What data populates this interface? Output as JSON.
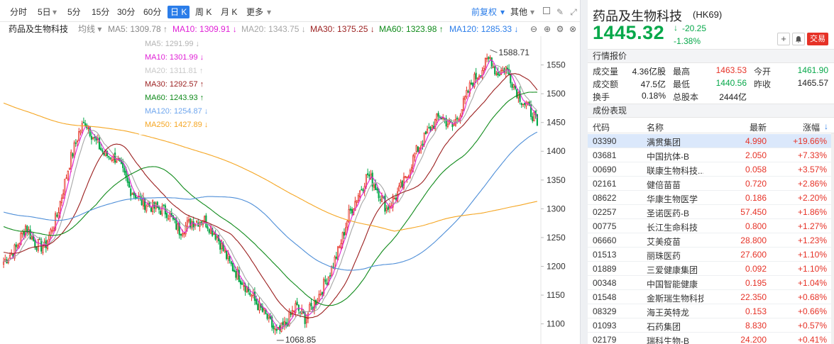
{
  "toolbar": {
    "periods": [
      "分时",
      "5日",
      "5分",
      "15分",
      "30分",
      "60分",
      "日 K",
      "周 K",
      "月 K",
      "更多"
    ],
    "active_index": 6,
    "fuquan": "前复权",
    "other": "其他"
  },
  "ma_bar": {
    "title": "药品及生物科技",
    "type_label": "均线",
    "items": [
      {
        "text": "MA5: 1309.78 ↑",
        "color": "#888888"
      },
      {
        "text": "MA10: 1309.91 ↓",
        "color": "#e021d6"
      },
      {
        "text": "MA20: 1343.75 ↓",
        "color": "#a6a6a6"
      },
      {
        "text": "MA30: 1375.25 ↓",
        "color": "#9b1f1f"
      },
      {
        "text": "MA60: 1323.98 ↑",
        "color": "#0f8a1a"
      },
      {
        "text": "MA120: 1285.33 ↓",
        "color": "#2b7de9"
      }
    ]
  },
  "chart_data": {
    "type": "candlestick",
    "y_ticks": [
      1100,
      1150,
      1200,
      1250,
      1300,
      1350,
      1400,
      1450,
      1500,
      1550
    ],
    "ylim": [
      1065,
      1600
    ],
    "high_label": "1588.71",
    "low_label": "1068.85",
    "last_close": 1445.32,
    "legend": [
      {
        "text": "MA5: 1291.99 ↓",
        "color": "#b3b3b3"
      },
      {
        "text": "MA10: 1301.99 ↓",
        "color": "#e021d6"
      },
      {
        "text": "MA20: 1311.81 ↑",
        "color": "#c9c9c9"
      },
      {
        "text": "MA30: 1292.57 ↑",
        "color": "#9b1f1f"
      },
      {
        "text": "MA60: 1243.93 ↑",
        "color": "#0f8a1a"
      },
      {
        "text": "MA120: 1254.87 ↓",
        "color": "#6fa6ee"
      },
      {
        "text": "MA250: 1427.89 ↓",
        "color": "#f5a623"
      }
    ],
    "anchors": [
      [
        0,
        1208
      ],
      [
        8,
        1232
      ],
      [
        14,
        1270
      ],
      [
        20,
        1240
      ],
      [
        26,
        1232
      ],
      [
        34,
        1288
      ],
      [
        42,
        1380
      ],
      [
        48,
        1432
      ],
      [
        52,
        1452
      ],
      [
        58,
        1420
      ],
      [
        64,
        1395
      ],
      [
        72,
        1388
      ],
      [
        80,
        1336
      ],
      [
        88,
        1312
      ],
      [
        96,
        1302
      ],
      [
        104,
        1295
      ],
      [
        112,
        1262
      ],
      [
        120,
        1278
      ],
      [
        128,
        1280
      ],
      [
        136,
        1252
      ],
      [
        144,
        1205
      ],
      [
        152,
        1175
      ],
      [
        160,
        1140
      ],
      [
        168,
        1110
      ],
      [
        174,
        1082
      ],
      [
        180,
        1100
      ],
      [
        186,
        1130
      ],
      [
        192,
        1110
      ],
      [
        200,
        1145
      ],
      [
        208,
        1190
      ],
      [
        214,
        1232
      ],
      [
        220,
        1290
      ],
      [
        226,
        1325
      ],
      [
        232,
        1360
      ],
      [
        238,
        1335
      ],
      [
        244,
        1300
      ],
      [
        250,
        1322
      ],
      [
        256,
        1350
      ],
      [
        262,
        1395
      ],
      [
        270,
        1432
      ],
      [
        278,
        1462
      ],
      [
        286,
        1442
      ],
      [
        292,
        1475
      ],
      [
        298,
        1518
      ],
      [
        304,
        1540
      ],
      [
        310,
        1562
      ],
      [
        314,
        1535
      ],
      [
        320,
        1545
      ],
      [
        326,
        1510
      ],
      [
        330,
        1490
      ],
      [
        334,
        1475
      ],
      [
        338,
        1460
      ],
      [
        340,
        1445.32
      ]
    ],
    "ma_specs": [
      {
        "name": "MA5",
        "period": 5,
        "color": "#e021d6"
      },
      {
        "name": "MA10",
        "period": 10,
        "color": "#a6a6a6"
      },
      {
        "name": "MA30",
        "period": 30,
        "color": "#9b1f1f"
      },
      {
        "name": "MA60",
        "period": 60,
        "color": "#0f8a1a"
      },
      {
        "name": "MA120",
        "period": 120,
        "color": "#4f8fd8"
      },
      {
        "name": "MA250",
        "period": 250,
        "color": "#f5a623"
      }
    ]
  },
  "quote": {
    "name": "药品及生物科技",
    "code": "(HK69)",
    "price": "1445.32",
    "arrow": "↓",
    "change": "-20.25",
    "change_pct": "-1.38%",
    "trade_label": "交易",
    "section_title": "行情报价",
    "stats": [
      {
        "label": "成交量",
        "value": "4.36亿股",
        "color": "normal"
      },
      {
        "label": "最高",
        "value": "1463.53",
        "color": "red"
      },
      {
        "label": "今开",
        "value": "1461.90",
        "color": "green"
      },
      {
        "label": "成交额",
        "value": "47.5亿",
        "color": "normal"
      },
      {
        "label": "最低",
        "value": "1440.56",
        "color": "green"
      },
      {
        "label": "昨收",
        "value": "1465.57",
        "color": "normal"
      },
      {
        "label": "换手",
        "value": "0.18%",
        "color": "normal"
      },
      {
        "label": "总股本",
        "value": "2444亿",
        "color": "normal"
      }
    ]
  },
  "components": {
    "title": "成份表现",
    "headers": [
      "代码",
      "名称",
      "最新",
      "涨幅"
    ],
    "sort_indicator": "↓",
    "rows": [
      {
        "code": "03390",
        "name": "满贯集团",
        "price": "4.990",
        "pct": "+19.66%"
      },
      {
        "code": "03681",
        "name": "中国抗体-B",
        "price": "2.050",
        "pct": "+7.33%"
      },
      {
        "code": "00690",
        "name": "联康生物科技...",
        "price": "0.058",
        "pct": "+3.57%"
      },
      {
        "code": "02161",
        "name": "健倍苗苗",
        "price": "0.720",
        "pct": "+2.86%"
      },
      {
        "code": "08622",
        "name": "华康生物医学",
        "price": "0.186",
        "pct": "+2.20%"
      },
      {
        "code": "02257",
        "name": "圣诺医药-B",
        "price": "57.450",
        "pct": "+1.86%"
      },
      {
        "code": "00775",
        "name": "长江生命科技",
        "price": "0.800",
        "pct": "+1.27%"
      },
      {
        "code": "06660",
        "name": "艾美疫苗",
        "price": "28.800",
        "pct": "+1.23%"
      },
      {
        "code": "01513",
        "name": "丽珠医药",
        "price": "27.600",
        "pct": "+1.10%"
      },
      {
        "code": "01889",
        "name": "三爱健康集团",
        "price": "0.092",
        "pct": "+1.10%"
      },
      {
        "code": "00348",
        "name": "中国智能健康",
        "price": "0.195",
        "pct": "+1.04%"
      },
      {
        "code": "01548",
        "name": "金斯瑞生物科技",
        "price": "22.350",
        "pct": "+0.68%"
      },
      {
        "code": "08329",
        "name": "海王英特龙",
        "price": "0.153",
        "pct": "+0.66%"
      },
      {
        "code": "01093",
        "name": "石药集团",
        "price": "8.830",
        "pct": "+0.57%"
      },
      {
        "code": "02179",
        "name": "瑞科生物-B",
        "price": "24.200",
        "pct": "+0.41%"
      }
    ]
  }
}
